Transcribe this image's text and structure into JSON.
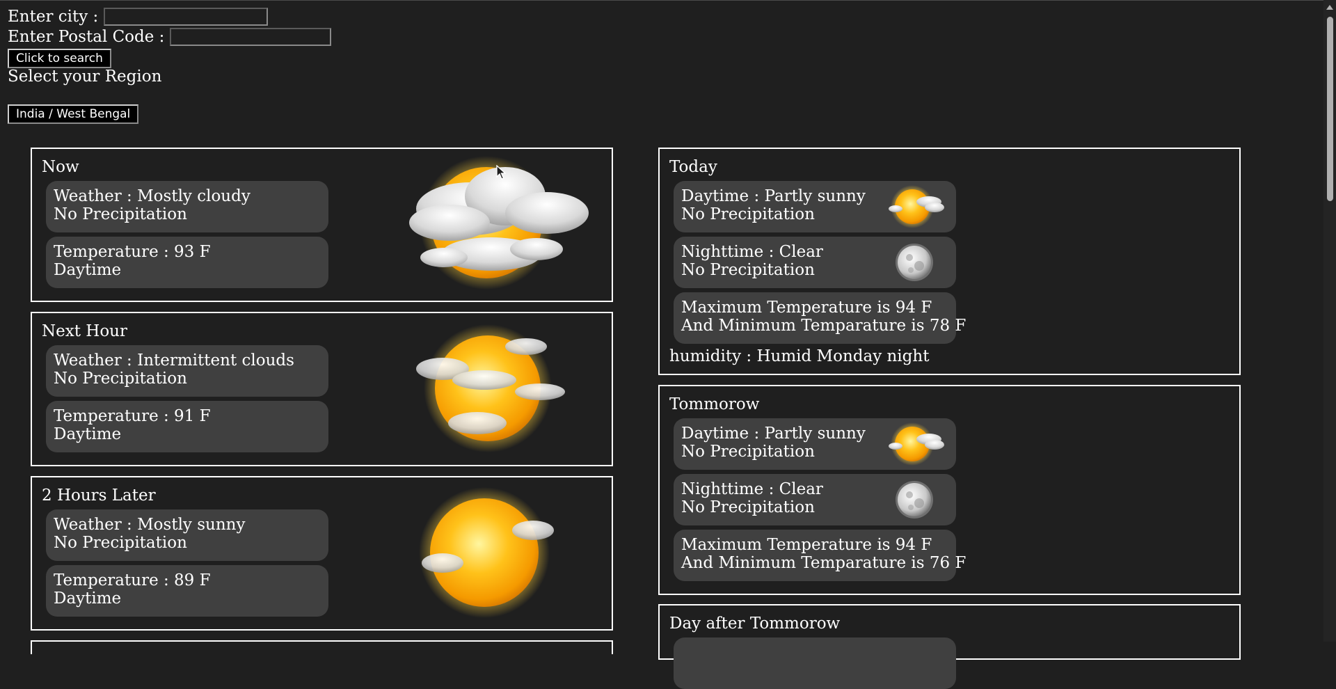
{
  "search": {
    "city_label": "Enter city :",
    "city_value": "",
    "postal_label": "Enter Postal Code :",
    "postal_value": "",
    "search_button": "Click to search",
    "region_label": "Select your Region",
    "region_button": "India / West Bengal"
  },
  "hourly": [
    {
      "title": "Now",
      "weather": "Weather : Mostly cloudy",
      "precip": "No Precipitation",
      "temp": "Temperature : 93 F",
      "period": "Daytime",
      "icon": "mostly-cloudy-icon"
    },
    {
      "title": "Next Hour",
      "weather": "Weather : Intermittent clouds",
      "precip": "No Precipitation",
      "temp": "Temperature : 91 F",
      "period": "Daytime",
      "icon": "intermittent-clouds-icon"
    },
    {
      "title": "2 Hours Later",
      "weather": "Weather : Mostly sunny",
      "precip": "No Precipitation",
      "temp": "Temperature : 89 F",
      "period": "Daytime",
      "icon": "mostly-sunny-icon"
    }
  ],
  "daily": [
    {
      "title": "Today",
      "day": "Daytime : Partly sunny",
      "day_precip": "No Precipitation",
      "night": "Nighttime : Clear",
      "night_precip": "No Precipitation",
      "max": "Maximum Temperature is 94 F",
      "min": "And Minimum Temparature is 78 F",
      "humidity": "humidity : Humid Monday night"
    },
    {
      "title": "Tommorow",
      "day": "Daytime : Partly sunny",
      "day_precip": "No Precipitation",
      "night": "Nighttime : Clear",
      "night_precip": "No Precipitation",
      "max": "Maximum Temperature is 94 F",
      "min": "And Minimum Temparature is 76 F"
    },
    {
      "title": "Day after Tommorow"
    }
  ],
  "colors": {
    "background": "#1f1f1f",
    "pill": "#404040",
    "border": "#ffffff",
    "sun": "#ffb400"
  }
}
